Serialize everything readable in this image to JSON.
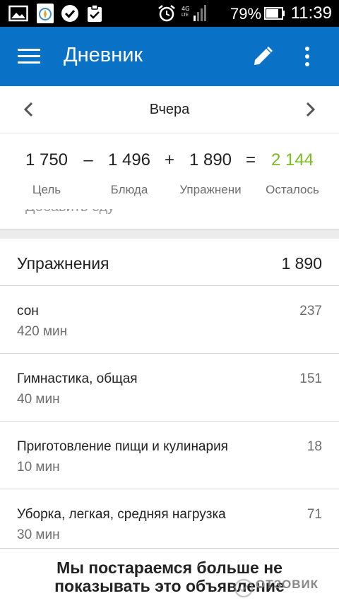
{
  "status_bar": {
    "battery_percent": "79%",
    "time": "11:39",
    "network": "4G LTE"
  },
  "app_bar": {
    "title": "Дневник",
    "icons": [
      "menu-icon",
      "edit-icon",
      "more-vert-icon"
    ]
  },
  "date_nav": {
    "label": "Вчера"
  },
  "summary": {
    "goal": {
      "value": "1 750",
      "label": "Цель"
    },
    "op1": "–",
    "food": {
      "value": "1 496",
      "label": "Блюда"
    },
    "op2": "+",
    "exercise": {
      "value": "1 890",
      "label": "Упражнени"
    },
    "op3": "=",
    "remaining": {
      "value": "2 144",
      "label": "Осталось"
    },
    "remaining_color": "#7bbd1e"
  },
  "add_food": {
    "label": "Добавить еду"
  },
  "exercise_section": {
    "title": "Упражнения",
    "total": "1 890",
    "items": [
      {
        "name": "сон",
        "duration": "420 мин",
        "calories": "237"
      },
      {
        "name": "Гимнастика, общая",
        "duration": "40 мин",
        "calories": "151"
      },
      {
        "name": "Приготовление пищи и кулинария",
        "duration": "10 мин",
        "calories": "18"
      },
      {
        "name": "Уборка, легкая, средняя нагрузка",
        "duration": "30 мин",
        "calories": "71"
      }
    ]
  },
  "ad_banner": {
    "line1": "Мы постараемся больше не",
    "line2": "показывать это объявление"
  },
  "watermark": {
    "text": "ОТЗОВИК"
  },
  "colors": {
    "app_bar": "#0a72c6",
    "accent_green": "#7bbd1e"
  }
}
